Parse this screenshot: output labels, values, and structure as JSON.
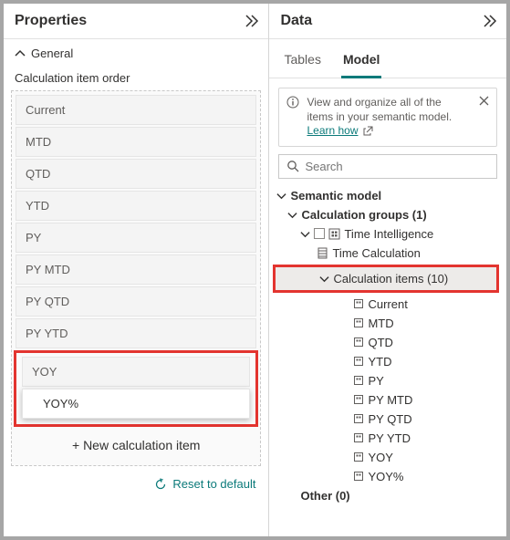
{
  "properties": {
    "title": "Properties",
    "general_label": "General",
    "calc_order_label": "Calculation item order",
    "items": {
      "i0": "Current",
      "i1": "MTD",
      "i2": "QTD",
      "i3": "YTD",
      "i4": "PY",
      "i5": "PY MTD",
      "i6": "PY QTD",
      "i7": "PY YTD",
      "i8": "YOY",
      "i9": "YOY%"
    },
    "new_item_label": "+ New calculation item",
    "reset_label": "Reset to default"
  },
  "data_pane": {
    "title": "Data",
    "tabs": {
      "tables": "Tables",
      "model": "Model"
    },
    "info": {
      "text": "View and organize all of the items in your semantic model. ",
      "link": "Learn how"
    },
    "search_placeholder": "Search",
    "tree": {
      "semantic_model": "Semantic model",
      "calc_groups": "Calculation groups (1)",
      "time_intel": "Time Intelligence",
      "time_calc": "Time Calculation",
      "calc_items": "Calculation items (10)",
      "leaves": {
        "l0": "Current",
        "l1": "MTD",
        "l2": "QTD",
        "l3": "YTD",
        "l4": "PY",
        "l5": "PY MTD",
        "l6": "PY QTD",
        "l7": "PY YTD",
        "l8": "YOY",
        "l9": "YOY%"
      },
      "other": "Other (0)"
    }
  }
}
